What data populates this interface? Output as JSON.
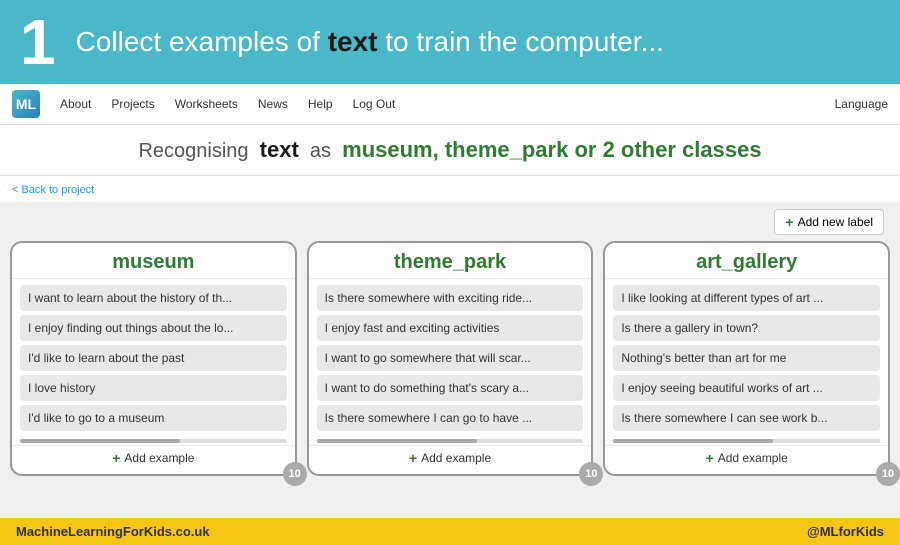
{
  "header": {
    "number": "1",
    "text_before": "Collect examples of ",
    "bold_word": "text",
    "text_after": " to train the computer..."
  },
  "navbar": {
    "about": "About",
    "projects": "Projects",
    "worksheets": "Worksheets",
    "news": "News",
    "help": "Help",
    "logout": "Log Out",
    "language": "Language"
  },
  "subtitle": {
    "prefix": "Recognising",
    "bold": "text",
    "middle": "as",
    "classes": "museum, theme_park or 2 other classes"
  },
  "back_link": "< Back to project",
  "toolbar": {
    "add_label": "Add new label"
  },
  "columns": [
    {
      "id": "museum",
      "title": "museum",
      "items": [
        "I want to learn about the history of th...",
        "I enjoy finding out things about the lo...",
        "I'd like to learn about the past",
        "I love history",
        "I'd like to go to a museum"
      ],
      "add_label": "Add example",
      "count": "10"
    },
    {
      "id": "theme_park",
      "title": "theme_park",
      "items": [
        "Is there somewhere with exciting ride...",
        "I enjoy fast and exciting activities",
        "I want to go somewhere that will scar...",
        "I want to do something that's scary a...",
        "Is there somewhere I can go to have ..."
      ],
      "add_label": "Add example",
      "count": "10"
    },
    {
      "id": "art_gallery",
      "title": "art_gallery",
      "items": [
        "I like looking at different types of art ...",
        "Is there a gallery in town?",
        "Nothing's better than art for me",
        "I enjoy seeing beautiful works of art ...",
        "Is there somewhere I can see work b..."
      ],
      "add_label": "Add example",
      "count": "10"
    }
  ],
  "footer": {
    "left": "MachineLearningForKids.co.uk",
    "right": "@MLforKids"
  }
}
